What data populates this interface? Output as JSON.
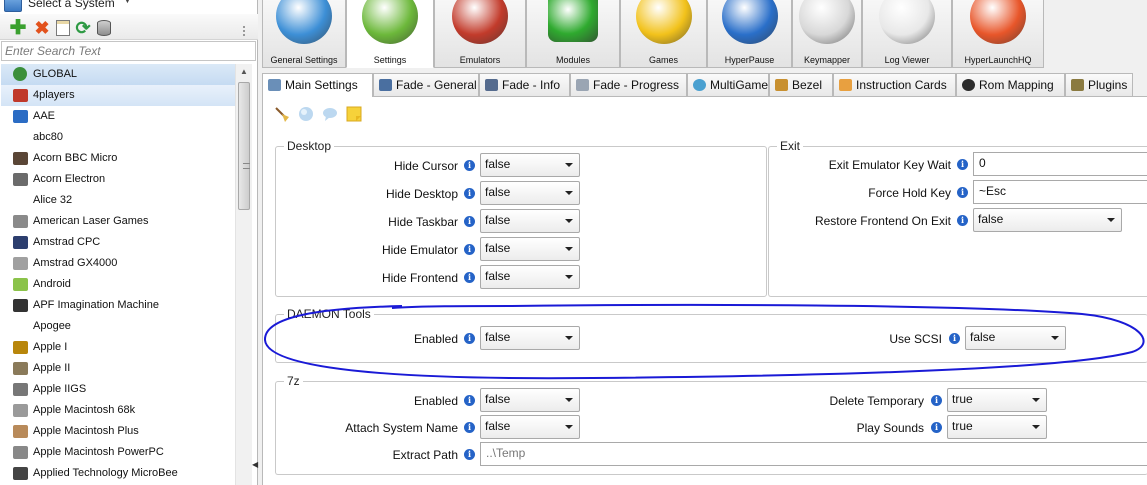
{
  "system_select": {
    "label": "Select a System"
  },
  "search": {
    "placeholder": "Enter Search Text"
  },
  "systems": [
    {
      "label": "GLOBAL",
      "selected": true,
      "color": "#3b8f3b"
    },
    {
      "label": "4players",
      "hover": true,
      "color": "#c0392b"
    },
    {
      "label": "AAE",
      "color": "#2b6cc4"
    },
    {
      "label": "abc80",
      "color": ""
    },
    {
      "label": "Acorn BBC Micro",
      "color": "#5a4636"
    },
    {
      "label": "Acorn Electron",
      "color": "#6b6b6b"
    },
    {
      "label": "Alice 32",
      "color": ""
    },
    {
      "label": "American Laser Games",
      "color": "#8a8a8a"
    },
    {
      "label": "Amstrad CPC",
      "color": "#2c3e6e"
    },
    {
      "label": "Amstrad GX4000",
      "color": "#a0a0a0"
    },
    {
      "label": "Android",
      "color": "#8bc34a"
    },
    {
      "label": "APF Imagination Machine",
      "color": "#333333"
    },
    {
      "label": "Apogee",
      "color": ""
    },
    {
      "label": "Apple I",
      "color": "#b8860b"
    },
    {
      "label": "Apple II",
      "color": "#8a7a5a"
    },
    {
      "label": "Apple IIGS",
      "color": "#777777"
    },
    {
      "label": "Apple Macintosh 68k",
      "color": "#9a9a9a"
    },
    {
      "label": "Apple Macintosh Plus",
      "color": "#b88a5a"
    },
    {
      "label": "Apple Macintosh PowerPC",
      "color": "#888888"
    },
    {
      "label": "Applied Technology MicroBee",
      "color": "#444444"
    }
  ],
  "main_tabs": [
    {
      "label": "General Settings",
      "color": "#3d8fd6"
    },
    {
      "label": "Settings",
      "color": "#6cb83a",
      "active": true
    },
    {
      "label": "Emulators",
      "color": "#c23b2b"
    },
    {
      "label": "Modules",
      "color": "#2faa2f"
    },
    {
      "label": "Games",
      "color": "#f2c21b"
    },
    {
      "label": "HyperPause",
      "color": "#2a6fc9"
    },
    {
      "label": "Keymapper",
      "color": "#d8d8d8"
    },
    {
      "label": "Log Viewer",
      "color": "#e8e8e8"
    },
    {
      "label": "HyperLaunchHQ",
      "color": "#e8562a"
    }
  ],
  "sub_tabs": [
    {
      "label": "Main Settings",
      "active": true
    },
    {
      "label": "Fade - General"
    },
    {
      "label": "Fade - Info"
    },
    {
      "label": "Fade - Progress"
    },
    {
      "label": "MultiGame"
    },
    {
      "label": "Bezel"
    },
    {
      "label": "Instruction Cards"
    },
    {
      "label": "Rom Mapping"
    },
    {
      "label": "Plugins"
    }
  ],
  "desktop": {
    "title": "Desktop",
    "hide_cursor": {
      "label": "Hide Cursor",
      "value": "false"
    },
    "hide_desktop": {
      "label": "Hide Desktop",
      "value": "false"
    },
    "hide_taskbar": {
      "label": "Hide Taskbar",
      "value": "false"
    },
    "hide_emulator": {
      "label": "Hide Emulator",
      "value": "false"
    },
    "hide_frontend": {
      "label": "Hide Frontend",
      "value": "false"
    }
  },
  "exit": {
    "title": "Exit",
    "exit_key_wait": {
      "label": "Exit Emulator Key Wait",
      "value": "0"
    },
    "force_hold_key": {
      "label": "Force Hold Key",
      "value": "~Esc"
    },
    "restore_frontend": {
      "label": "Restore Frontend On Exit",
      "value": "false"
    }
  },
  "daemon": {
    "title": "DAEMON Tools",
    "enabled": {
      "label": "Enabled",
      "value": "false"
    },
    "use_scsi": {
      "label": "Use SCSI",
      "value": "false"
    }
  },
  "sevenz": {
    "title": "7z",
    "enabled": {
      "label": "Enabled",
      "value": "false"
    },
    "attach_system_name": {
      "label": "Attach System Name",
      "value": "false"
    },
    "extract_path": {
      "label": "Extract Path",
      "value": "..\\Temp"
    },
    "delete_temporary": {
      "label": "Delete Temporary",
      "value": "true"
    },
    "play_sounds": {
      "label": "Play Sounds",
      "value": "true"
    }
  },
  "colors": {
    "info": "#2563c7",
    "annotation": "#1a1ad6",
    "selected": "#c5dbf2"
  }
}
